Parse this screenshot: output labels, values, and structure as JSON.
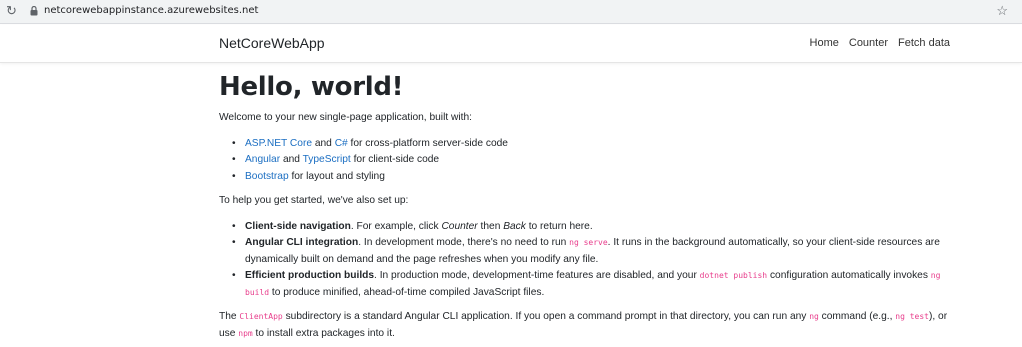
{
  "browser": {
    "url": "netcorewebappinstance.azurewebsites.net"
  },
  "navbar": {
    "brand": "NetCoreWebApp",
    "links": [
      "Home",
      "Counter",
      "Fetch data"
    ]
  },
  "main": {
    "heading": "Hello, world!",
    "intro": "Welcome to your new single-page application, built with:",
    "built_with": [
      {
        "link1": "ASP.NET Core",
        "mid": " and ",
        "link2": "C#",
        "tail": " for cross-platform server-side code"
      },
      {
        "link1": "Angular",
        "mid": " and ",
        "link2": "TypeScript",
        "tail": " for client-side code"
      },
      {
        "link1": "Bootstrap",
        "tail": " for layout and styling"
      }
    ],
    "setup_intro": "To help you get started, we've also set up:",
    "setup": [
      {
        "bold": "Client-side navigation",
        "text_a": ". For example, click ",
        "em1": "Counter",
        "text_b": " then ",
        "em2": "Back",
        "text_c": " to return here."
      },
      {
        "bold": "Angular CLI integration",
        "text_a": ". In development mode, there's no need to run ",
        "code1": "ng serve",
        "text_b": ". It runs in the background automatically, so your client-side resources are dynamically built on demand and the page refreshes when you modify any file."
      },
      {
        "bold": "Efficient production builds",
        "text_a": ". In production mode, development-time features are disabled, and your ",
        "code1": "dotnet publish",
        "text_b": " configuration automatically invokes ",
        "code2": "ng build",
        "text_c": " to produce minified, ahead-of-time compiled JavaScript files."
      }
    ],
    "footer": {
      "text_a": "The ",
      "code1": "ClientApp",
      "text_b": " subdirectory is a standard Angular CLI application. If you open a command prompt in that directory, you can run any ",
      "code2": "ng",
      "text_c": " command (e.g., ",
      "code3": "ng test",
      "text_d": "), or use ",
      "code4": "npm",
      "text_e": " to install extra packages into it."
    }
  }
}
